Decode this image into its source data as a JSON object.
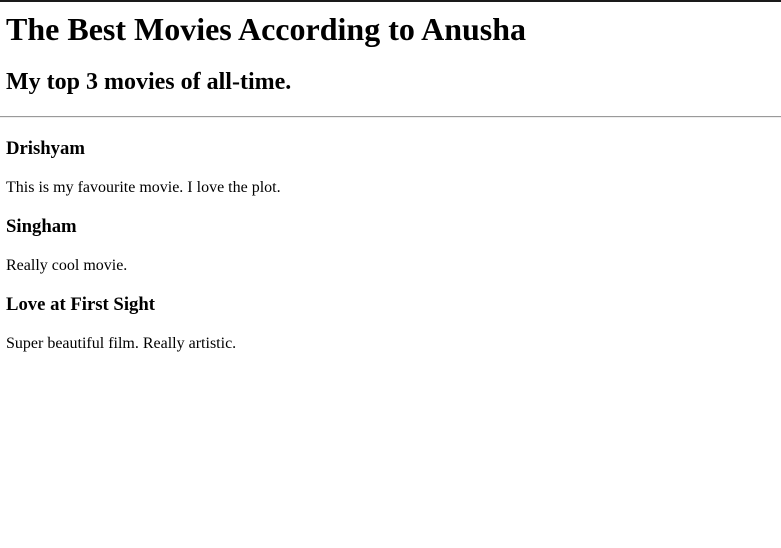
{
  "page": {
    "title": "The Best Movies According to Anusha",
    "subtitle": "My top 3 movies of all-time."
  },
  "movies": [
    {
      "name": "Drishyam",
      "description": "This is my favourite movie. I love the plot."
    },
    {
      "name": "Singham",
      "description": "Really cool movie."
    },
    {
      "name": "Love at First Sight",
      "description": "Super beautiful film. Really artistic."
    }
  ]
}
